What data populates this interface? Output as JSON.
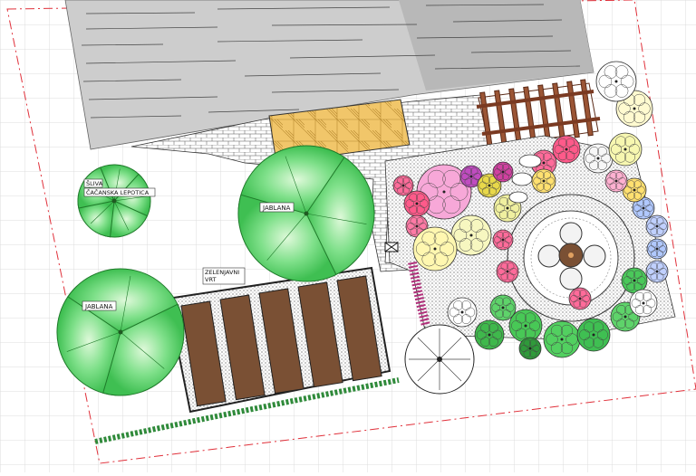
{
  "labels": {
    "plum_1": "ŠLIVA",
    "plum_2": "ČAČANSKA LEPOTICA",
    "apple_upper": "JABLANA",
    "apple_lower": "JABLANA",
    "garden_1": "ZELENJAVNI",
    "garden_2": "VRT"
  },
  "palette": {
    "background": "#ffffff",
    "grid": "#d9d9d9",
    "house_roof": "#cfcfcf",
    "house_roof_dark": "#b9b9b9",
    "paving": "#ffffff",
    "terrace": "#f0c868",
    "pergola": "#8a4a30",
    "bed_soil": "#7a5034",
    "bed_frame": "#2a2a2a",
    "tree_green": "#5ed36a",
    "tree_green_light": "#c8f5c0",
    "boundary": "#e0303a"
  },
  "icons": {
    "trees": "fruit-tree-icon",
    "shrubs": "shrub-symbol-icon",
    "table": "round-table-icon"
  }
}
